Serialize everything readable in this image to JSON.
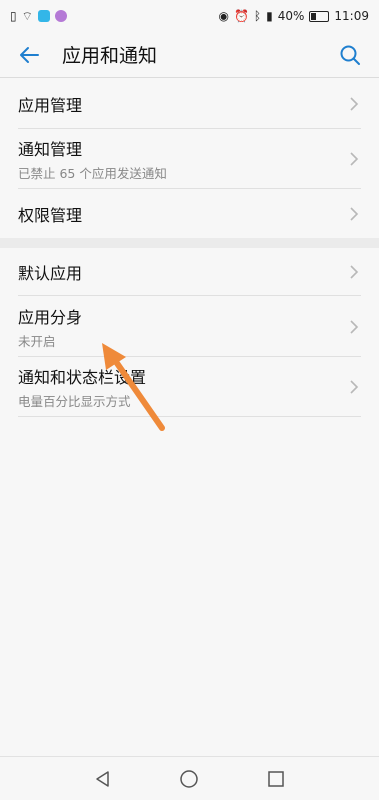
{
  "status_bar": {
    "battery": "40%",
    "time": "11:09"
  },
  "header": {
    "title": "应用和通知"
  },
  "section1": {
    "items": [
      {
        "label": "应用管理",
        "sub": ""
      },
      {
        "label": "通知管理",
        "sub": "已禁止 65 个应用发送通知"
      },
      {
        "label": "权限管理",
        "sub": ""
      }
    ]
  },
  "section2": {
    "items": [
      {
        "label": "默认应用",
        "sub": ""
      },
      {
        "label": "应用分身",
        "sub": "未开启"
      },
      {
        "label": "通知和状态栏设置",
        "sub": "电量百分比显示方式"
      }
    ]
  },
  "colors": {
    "accent": "#1f7fcf",
    "annotation_arrow": "#ef8a3a"
  }
}
